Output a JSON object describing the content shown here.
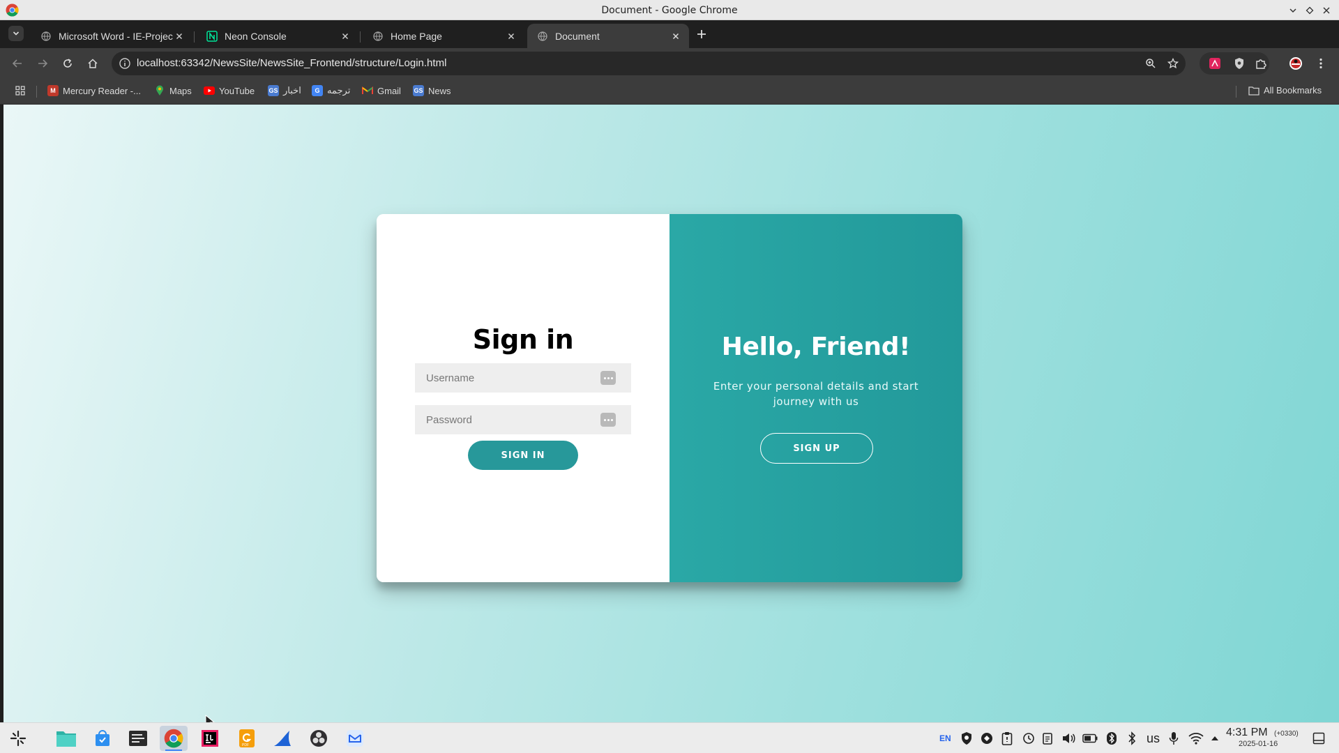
{
  "window": {
    "title": "Document - Google Chrome"
  },
  "tabs": [
    {
      "label": "Microsoft Word - IE-Project",
      "icon": "globe-icon"
    },
    {
      "label": "Neon Console",
      "icon": "neon-icon"
    },
    {
      "label": "Home Page",
      "icon": "globe-icon"
    },
    {
      "label": "Document",
      "icon": "globe-icon",
      "active": true
    }
  ],
  "toolbar": {
    "url": "localhost:63342/NewsSite/NewsSite_Frontend/structure/Login.html"
  },
  "bookmarks": {
    "items": [
      {
        "label": "Mercury Reader -...",
        "icon": "mercury-icon"
      },
      {
        "label": "Maps",
        "icon": "maps-icon"
      },
      {
        "label": "YouTube",
        "icon": "youtube-icon"
      },
      {
        "label": "اخبار",
        "icon": "news-g-icon"
      },
      {
        "label": "ترجمه",
        "icon": "translate-icon"
      },
      {
        "label": "Gmail",
        "icon": "gmail-icon"
      },
      {
        "label": "News",
        "icon": "news-g-icon"
      }
    ],
    "all_bookmarks": "All Bookmarks"
  },
  "page": {
    "signin": {
      "title": "Sign in",
      "username_placeholder": "Username",
      "password_placeholder": "Password",
      "button": "SIGN IN"
    },
    "welcome": {
      "title": "Hello, Friend!",
      "text": "Enter your personal details and start journey with us",
      "button": "SIGN UP"
    }
  },
  "taskbar": {
    "language": "EN",
    "layout": "us",
    "time": "4:31 PM",
    "timezone": "(+0330)",
    "date": "2025-01-16"
  },
  "colors": {
    "accent": "#27989a",
    "panel_right": "#2aa8a6",
    "background_light": "#eaf7f7",
    "background_dark": "#7fd6d4"
  }
}
